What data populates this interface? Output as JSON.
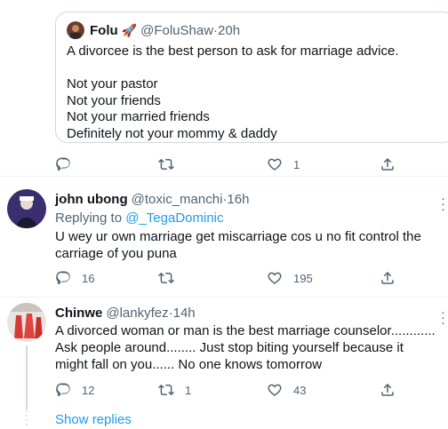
{
  "quote": {
    "name": "Folu",
    "emoji": "🚀",
    "handle": "@FoluShaw",
    "time": "20h",
    "lines": [
      "A divorcee is the best person to ask for marriage advice.",
      "",
      "Not your pastor",
      "Not your friends",
      "Not your married friends",
      "Definitely not your mommy & daddy"
    ]
  },
  "quote_actions": {
    "reply": "",
    "retweet": "",
    "like": "1"
  },
  "replies": [
    {
      "name": "john ubong",
      "handle": "@toxic_manchi",
      "time": "16h",
      "replying_prefix": "Replying to",
      "replying_to": "@_TegaDominic",
      "text": "U wey ur own marriage get miscarriage cos u no fit control the carriage of you puna",
      "reply_count": "16",
      "retweet_count": "",
      "like_count": "195"
    },
    {
      "name": "Chinwe",
      "handle": "@lankyfez",
      "time": "14h",
      "text": "A divorced woman or man is the best marriage counselor............ Ask people around........ Just stop biting yourself because it might fall on you...... No one knows tomorrow",
      "reply_count": "12",
      "retweet_count": "1",
      "like_count": "43"
    }
  ],
  "show_replies": "Show replies",
  "sep": " · "
}
